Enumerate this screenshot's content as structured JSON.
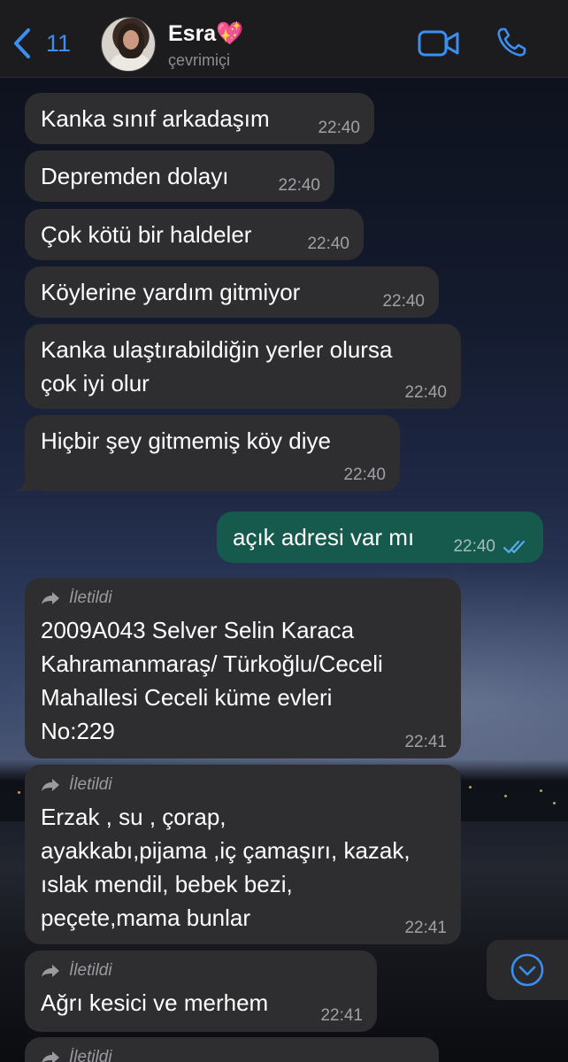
{
  "header": {
    "back_count": "11",
    "contact_name": "Esra",
    "contact_emoji": "💖",
    "contact_status": "çevrimiçi"
  },
  "colors": {
    "accent_blue": "#3b8ff0",
    "incoming_bubble": "#2e2e30",
    "outgoing_bubble": "#155a4d",
    "read_checks": "#5aa9f5"
  },
  "messages": [
    {
      "direction": "in",
      "text": "Kanka sınıf arkadaşım",
      "time": "22:40"
    },
    {
      "direction": "in",
      "text": "Depremden dolayı",
      "time": "22:40"
    },
    {
      "direction": "in",
      "text": "Çok kötü bir haldeler",
      "time": "22:40"
    },
    {
      "direction": "in",
      "text": "Köylerine yardım gitmiyor",
      "time": "22:40"
    },
    {
      "direction": "in",
      "lines": [
        "Kanka ulaştırabildiğin yerler olursa",
        "çok iyi olur"
      ],
      "time": "22:40"
    },
    {
      "direction": "in",
      "text": "Hiçbir şey gitmemiş köy diye",
      "time": "22:40"
    },
    {
      "direction": "out",
      "text": "açık adresi var mı",
      "time": "22:40",
      "status": "read"
    },
    {
      "direction": "in",
      "forwarded_label": "İletildi",
      "lines": [
        "2009A043 Selver Selin Karaca",
        "Kahramanmaraş/ Türkoğlu/Ceceli",
        "Mahallesi Ceceli küme evleri",
        "No:229"
      ],
      "time": "22:41"
    },
    {
      "direction": "in",
      "forwarded_label": "İletildi",
      "lines": [
        "Erzak , su , çorap,",
        "ayakkabı,pijama ,iç çamaşırı, kazak,",
        "ıslak mendil, bebek bezi,",
        "peçete,mama bunlar"
      ],
      "time": "22:41"
    },
    {
      "direction": "in",
      "forwarded_label": "İletildi",
      "text": "Ağrı kesici ve merhem",
      "time": "22:41"
    },
    {
      "direction": "in",
      "forwarded_label": "İletildi"
    }
  ]
}
